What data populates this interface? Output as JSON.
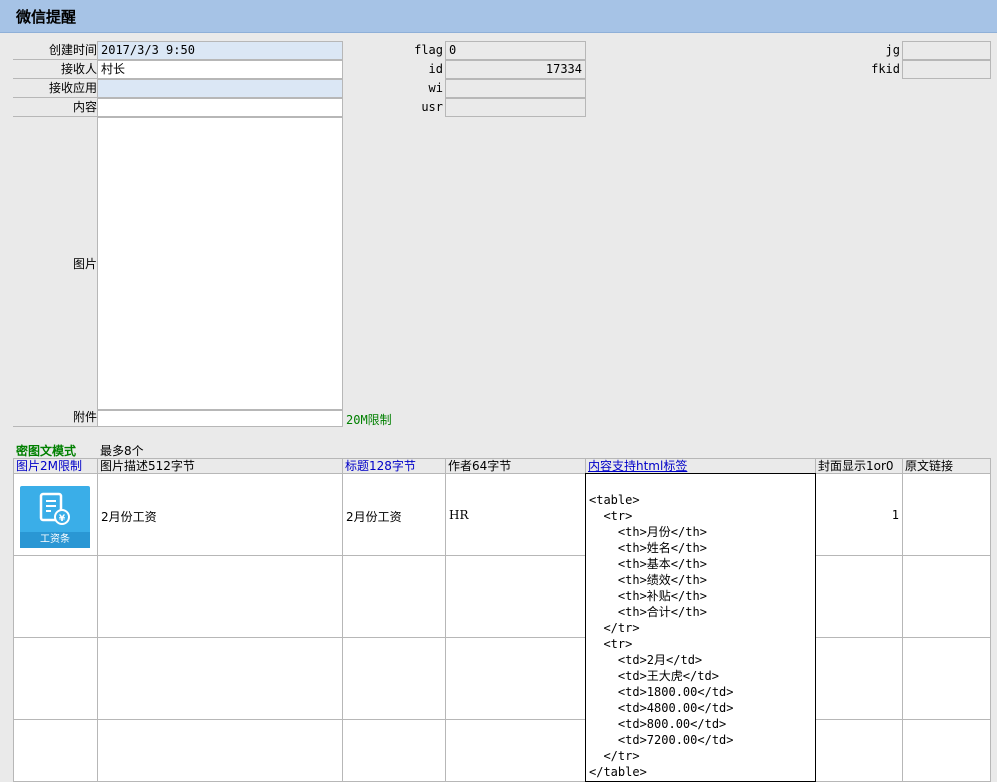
{
  "window": {
    "title": "微信提醒"
  },
  "form": {
    "created_label": "创建时间",
    "created_value": "2017/3/3 9:50",
    "receiver_label": "接收人",
    "receiver_value": "村长",
    "app_label": "接收应用",
    "app_value": "",
    "content_label": "内容",
    "content_value": "",
    "image_label": "图片",
    "attachment_label": "附件",
    "attachment_value": "",
    "attachment_hint": "20M限制",
    "flag_label": "flag",
    "flag_value": "0",
    "id_label": "id",
    "id_value": "17334",
    "wi_label": "wi",
    "wi_value": "",
    "usr_label": "usr",
    "usr_value": "",
    "jg_label": "jg",
    "jg_value": "",
    "fkid_label": "fkid",
    "fkid_value": ""
  },
  "news": {
    "mode_label": "密图文模式",
    "max_label": "最多8个",
    "headers": {
      "image": "图片2M限制",
      "desc": "图片描述512字节",
      "title": "标题128字节",
      "author": "作者64字节",
      "content": "内容支持html标签",
      "cover": "封面显示1or0",
      "link": "原文链接"
    },
    "rows": [
      {
        "thumb_label": "工资条",
        "desc": "2月份工资",
        "title": "2月份工资",
        "author": "HR",
        "content": "<table>\n  <tr>\n    <th>月份</th>\n    <th>姓名</th>\n    <th>基本</th>\n    <th>绩效</th>\n    <th>补贴</th>\n    <th>合计</th>\n  </tr>\n  <tr>\n    <td>2月</td>\n    <td>王大虎</td>\n    <td>1800.00</td>\n    <td>4800.00</td>\n    <td>800.00</td>\n    <td>7200.00</td>\n  </tr>\n</table>",
        "cover": "1",
        "link": ""
      }
    ]
  }
}
